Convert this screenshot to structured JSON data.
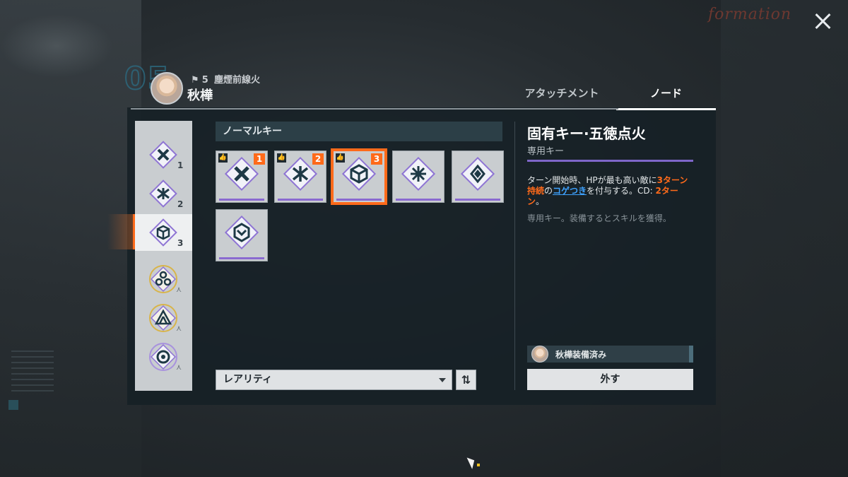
{
  "header": {
    "formation_label": "formation",
    "big_number": "05",
    "team_number": "5",
    "team_name": "塵煙前線火",
    "character_name": "秋樺"
  },
  "tabs": [
    {
      "label": "アタッチメント",
      "active": false
    },
    {
      "label": "ノード",
      "active": true
    }
  ],
  "slots": [
    {
      "number": "1",
      "icon": "cross-node-icon",
      "locked": false,
      "active": false
    },
    {
      "number": "2",
      "icon": "split-node-icon",
      "locked": false,
      "active": false
    },
    {
      "number": "3",
      "icon": "cube-node-icon",
      "locked": false,
      "active": true
    },
    {
      "icon": "triskelion-node-icon",
      "locked": true,
      "ring": "gold"
    },
    {
      "icon": "triangle-node-icon",
      "locked": true,
      "ring": "gold"
    },
    {
      "icon": "target-node-icon",
      "locked": true,
      "ring": "purple"
    }
  ],
  "keys": {
    "section_title": "ノーマルキー",
    "items": [
      {
        "icon": "cross-key-icon",
        "recommended": true,
        "rank": "1",
        "selected": false
      },
      {
        "icon": "split-key-icon",
        "recommended": true,
        "rank": "2",
        "selected": false
      },
      {
        "icon": "cube-key-icon",
        "recommended": true,
        "rank": "3",
        "selected": true
      },
      {
        "icon": "lattice-key-icon",
        "recommended": false,
        "rank": "",
        "selected": false
      },
      {
        "icon": "diamond-key-icon",
        "recommended": false,
        "rank": "",
        "selected": false
      },
      {
        "icon": "hex-key-icon",
        "recommended": false,
        "rank": "",
        "selected": false
      }
    ],
    "sort_label": "レアリティ"
  },
  "detail": {
    "title": "固有キー·五徳点火",
    "subtitle": "専用キー",
    "desc_1": "ターン開始時、HPが最も高い敵に",
    "desc_hl1": "3ターン持続",
    "desc_2": "の",
    "desc_link": "コゲつき",
    "desc_3": "を付与する。CD: ",
    "desc_hl2": "2ターン",
    "desc_4": "。",
    "note": "専用キー。装備するとスキルを獲得。",
    "equipped_by": "秋樺装備済み",
    "remove_label": "外す"
  },
  "colors": {
    "accent_orange": "#ff6a1a",
    "rarity_purple": "#7e66c9",
    "link_blue": "#3ea2ff"
  }
}
